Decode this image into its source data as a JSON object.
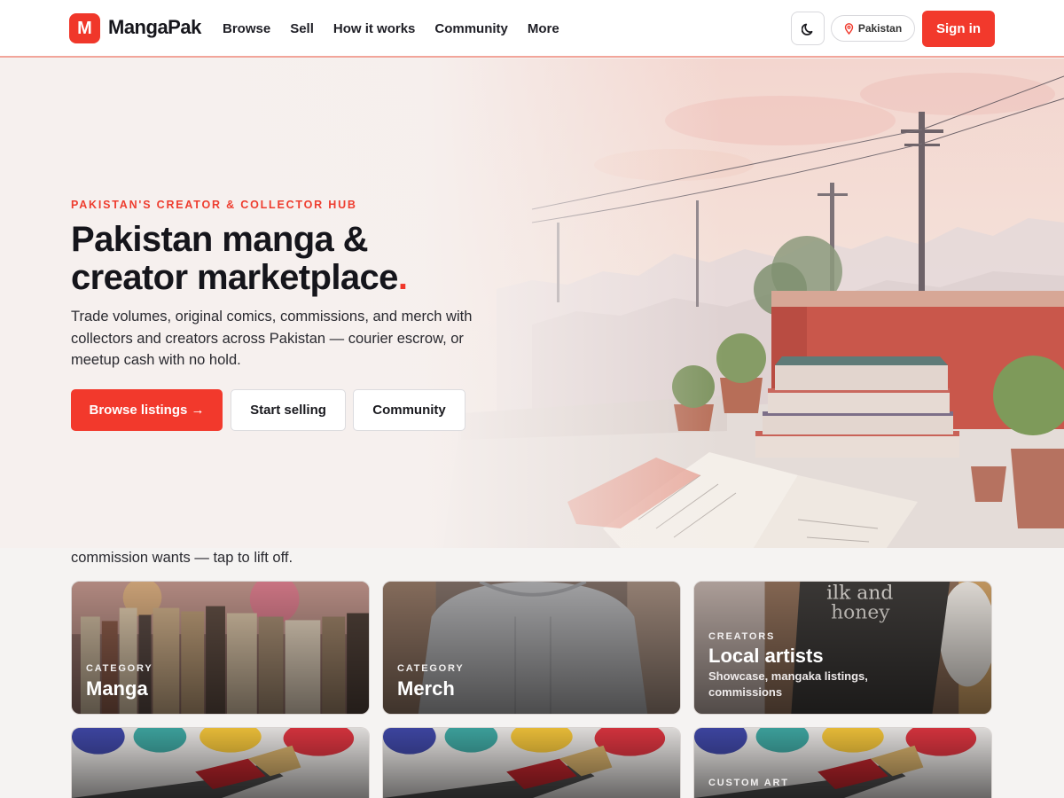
{
  "header": {
    "logo_letter": "M",
    "brand": "MangaPak",
    "nav": [
      "Browse",
      "Sell",
      "How it works",
      "Community",
      "More"
    ],
    "theme_icon": "moon-icon",
    "region": "Pakistan",
    "region_icon": "location-pin-icon",
    "signin": "Sign in"
  },
  "hero": {
    "eyebrow": "PAKISTAN'S CREATOR & COLLECTOR HUB",
    "title_line1": "Pakistan manga &",
    "title_line2": "creator marketplace",
    "title_dot": ".",
    "subtitle": "Trade volumes, original comics, commissions, and merch with collectors and creators across Pakistan — courier escrow, or meetup cash with no hold.",
    "cta_primary": "Browse listings →",
    "cta_secondary": "Start selling",
    "cta_tertiary": "Community"
  },
  "hint": "commission wants — tap to lift off.",
  "cards": [
    {
      "kicker": "CATEGORY",
      "title": "Manga"
    },
    {
      "kicker": "CATEGORY",
      "title": "Merch"
    },
    {
      "kicker": "CREATORS",
      "title": "Local artists",
      "desc": "Showcase, mangaka listings, commissions"
    },
    {
      "kicker": "",
      "title": ""
    },
    {
      "kicker": "",
      "title": ""
    },
    {
      "kicker": "CUSTOM ART",
      "title": ""
    }
  ],
  "colors": {
    "accent": "#f2392c",
    "text": "#15151b",
    "bg": "#f5f3f2"
  }
}
